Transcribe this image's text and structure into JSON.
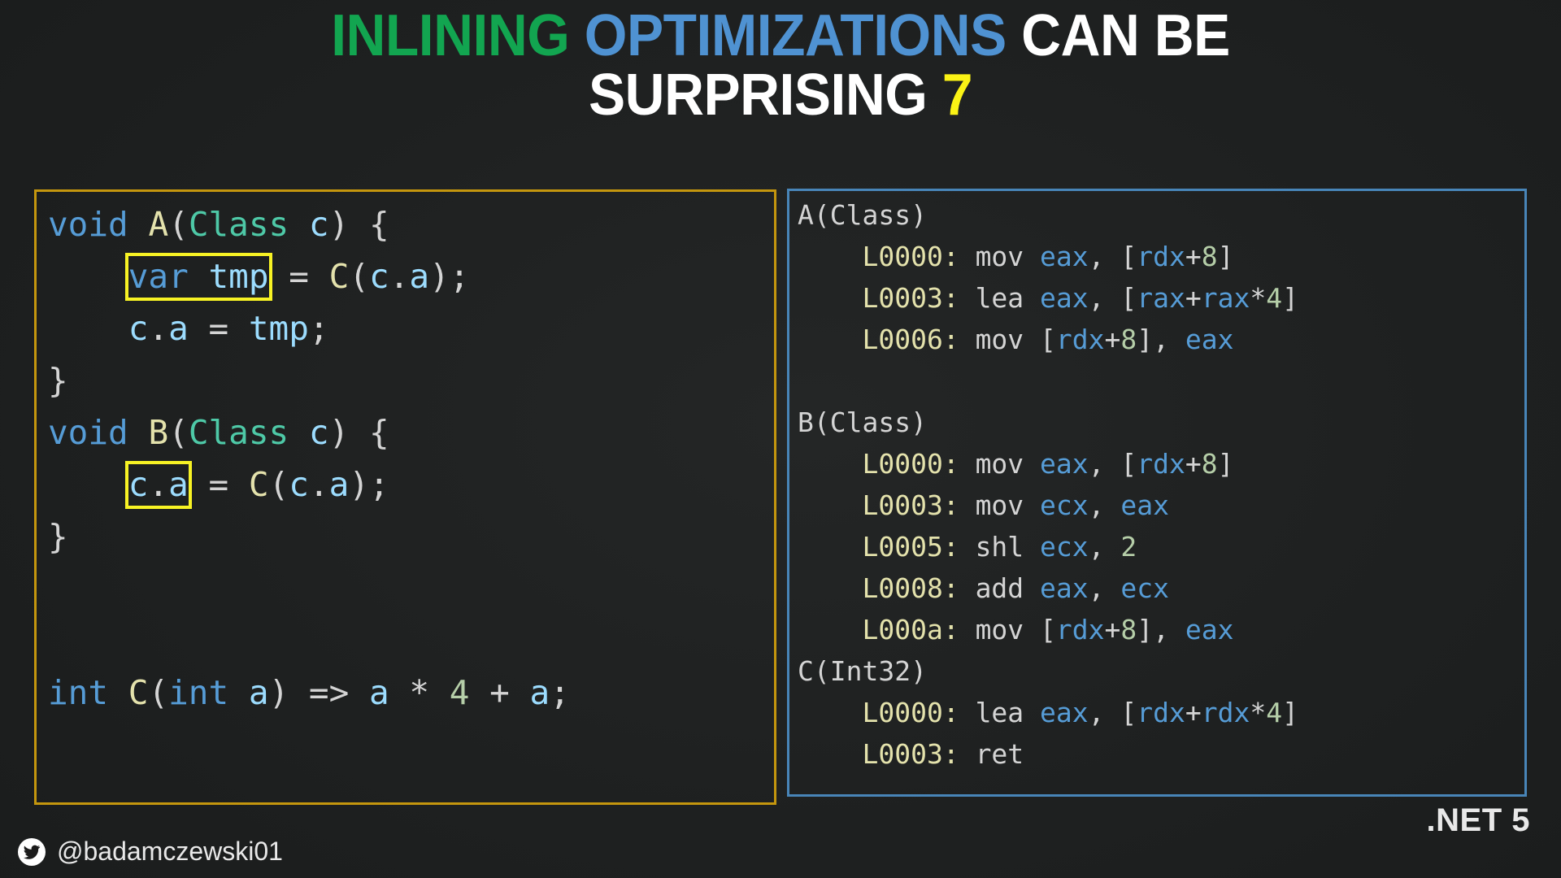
{
  "title": {
    "line1_part1": "INLINING",
    "line1_part2": "OPTIMIZATIONS",
    "line1_part3": "CAN BE",
    "line2_part1": "SURPRISING",
    "line2_part2": "7",
    "colors": {
      "green": "#12a550",
      "blue": "#4f92d2",
      "white": "#ffffff",
      "yellow": "#fbf315"
    }
  },
  "code_panel": {
    "border_color": "#c4960e",
    "highlight_color": "#f7f224",
    "lines": [
      {
        "id": "l1",
        "tokens": [
          {
            "t": "void",
            "c": "kw"
          },
          {
            "t": " ",
            "c": "punct"
          },
          {
            "t": "A",
            "c": "fn"
          },
          {
            "t": "(",
            "c": "punct"
          },
          {
            "t": "Class",
            "c": "type"
          },
          {
            "t": " ",
            "c": "punct"
          },
          {
            "t": "c",
            "c": "var"
          },
          {
            "t": ") {",
            "c": "punct"
          }
        ]
      },
      {
        "id": "l2",
        "indent": 4,
        "highlight": "var tmp",
        "tokens": [
          {
            "t": "var",
            "c": "kw"
          },
          {
            "t": " ",
            "c": "punct"
          },
          {
            "t": "tmp",
            "c": "var"
          }
        ],
        "after": [
          {
            "t": " = ",
            "c": "op"
          },
          {
            "t": "C",
            "c": "fn"
          },
          {
            "t": "(",
            "c": "punct"
          },
          {
            "t": "c",
            "c": "var"
          },
          {
            "t": ".",
            "c": "punct"
          },
          {
            "t": "a",
            "c": "var"
          },
          {
            "t": ");",
            "c": "punct"
          }
        ]
      },
      {
        "id": "l3",
        "indent": 4,
        "tokens": [
          {
            "t": "c",
            "c": "var"
          },
          {
            "t": ".",
            "c": "punct"
          },
          {
            "t": "a",
            "c": "var"
          },
          {
            "t": " = ",
            "c": "op"
          },
          {
            "t": "tmp",
            "c": "var"
          },
          {
            "t": ";",
            "c": "punct"
          }
        ]
      },
      {
        "id": "l4",
        "tokens": [
          {
            "t": "}",
            "c": "punct"
          }
        ]
      },
      {
        "id": "l5",
        "tokens": [
          {
            "t": "void",
            "c": "kw"
          },
          {
            "t": " ",
            "c": "punct"
          },
          {
            "t": "B",
            "c": "fn"
          },
          {
            "t": "(",
            "c": "punct"
          },
          {
            "t": "Class",
            "c": "type"
          },
          {
            "t": " ",
            "c": "punct"
          },
          {
            "t": "c",
            "c": "var"
          },
          {
            "t": ") {",
            "c": "punct"
          }
        ]
      },
      {
        "id": "l6",
        "indent": 4,
        "highlight": "c.a",
        "tokens": [
          {
            "t": "c",
            "c": "var"
          },
          {
            "t": ".",
            "c": "punct"
          },
          {
            "t": "a",
            "c": "var"
          }
        ],
        "after": [
          {
            "t": " = ",
            "c": "op"
          },
          {
            "t": "C",
            "c": "fn"
          },
          {
            "t": "(",
            "c": "punct"
          },
          {
            "t": "c",
            "c": "var"
          },
          {
            "t": ".",
            "c": "punct"
          },
          {
            "t": "a",
            "c": "var"
          },
          {
            "t": ");",
            "c": "punct"
          }
        ]
      },
      {
        "id": "l7",
        "tokens": [
          {
            "t": "}",
            "c": "punct"
          }
        ]
      },
      {
        "id": "l8",
        "tokens": []
      },
      {
        "id": "l9",
        "tokens": []
      },
      {
        "id": "l10",
        "tokens": [
          {
            "t": "int",
            "c": "kw"
          },
          {
            "t": " ",
            "c": "punct"
          },
          {
            "t": "C",
            "c": "fn"
          },
          {
            "t": "(",
            "c": "punct"
          },
          {
            "t": "int",
            "c": "kw"
          },
          {
            "t": " ",
            "c": "punct"
          },
          {
            "t": "a",
            "c": "var"
          },
          {
            "t": ")",
            "c": "punct"
          },
          {
            "t": " => ",
            "c": "op"
          },
          {
            "t": "a",
            "c": "var"
          },
          {
            "t": " ",
            "c": "punct"
          },
          {
            "t": "*",
            "c": "op"
          },
          {
            "t": " ",
            "c": "punct"
          },
          {
            "t": "4",
            "c": "num"
          },
          {
            "t": " ",
            "c": "punct"
          },
          {
            "t": "+",
            "c": "op"
          },
          {
            "t": " ",
            "c": "punct"
          },
          {
            "t": "a",
            "c": "var"
          },
          {
            "t": ";",
            "c": "punct"
          }
        ]
      }
    ]
  },
  "asm_panel": {
    "border_color": "#4885b8",
    "lines": [
      {
        "id": "a1",
        "tokens": [
          {
            "t": "A(Class)",
            "c": "sig"
          }
        ]
      },
      {
        "id": "a2",
        "indent": 4,
        "tokens": [
          {
            "t": "L0000: ",
            "c": "label"
          },
          {
            "t": "mov ",
            "c": "mn"
          },
          {
            "t": "eax",
            "c": "reg"
          },
          {
            "t": ", [",
            "c": "mn"
          },
          {
            "t": "rdx",
            "c": "reg"
          },
          {
            "t": "+",
            "c": "mn"
          },
          {
            "t": "8",
            "c": "asmnum"
          },
          {
            "t": "]",
            "c": "mn"
          }
        ]
      },
      {
        "id": "a3",
        "indent": 4,
        "tokens": [
          {
            "t": "L0003: ",
            "c": "label"
          },
          {
            "t": "lea ",
            "c": "mn"
          },
          {
            "t": "eax",
            "c": "reg"
          },
          {
            "t": ", [",
            "c": "mn"
          },
          {
            "t": "rax",
            "c": "reg"
          },
          {
            "t": "+",
            "c": "mn"
          },
          {
            "t": "rax",
            "c": "reg"
          },
          {
            "t": "*",
            "c": "mn"
          },
          {
            "t": "4",
            "c": "asmnum"
          },
          {
            "t": "]",
            "c": "mn"
          }
        ]
      },
      {
        "id": "a4",
        "indent": 4,
        "tokens": [
          {
            "t": "L0006: ",
            "c": "label"
          },
          {
            "t": "mov [",
            "c": "mn"
          },
          {
            "t": "rdx",
            "c": "reg"
          },
          {
            "t": "+",
            "c": "mn"
          },
          {
            "t": "8",
            "c": "asmnum"
          },
          {
            "t": "], ",
            "c": "mn"
          },
          {
            "t": "eax",
            "c": "reg"
          }
        ]
      },
      {
        "id": "a5",
        "tokens": []
      },
      {
        "id": "a6",
        "tokens": [
          {
            "t": "B(Class)",
            "c": "sig"
          }
        ]
      },
      {
        "id": "a7",
        "indent": 4,
        "tokens": [
          {
            "t": "L0000: ",
            "c": "label"
          },
          {
            "t": "mov ",
            "c": "mn"
          },
          {
            "t": "eax",
            "c": "reg"
          },
          {
            "t": ", [",
            "c": "mn"
          },
          {
            "t": "rdx",
            "c": "reg"
          },
          {
            "t": "+",
            "c": "mn"
          },
          {
            "t": "8",
            "c": "asmnum"
          },
          {
            "t": "]",
            "c": "mn"
          }
        ]
      },
      {
        "id": "a8",
        "indent": 4,
        "tokens": [
          {
            "t": "L0003: ",
            "c": "label"
          },
          {
            "t": "mov ",
            "c": "mn"
          },
          {
            "t": "ecx",
            "c": "reg"
          },
          {
            "t": ", ",
            "c": "mn"
          },
          {
            "t": "eax",
            "c": "reg"
          }
        ]
      },
      {
        "id": "a9",
        "indent": 4,
        "tokens": [
          {
            "t": "L0005: ",
            "c": "label"
          },
          {
            "t": "shl ",
            "c": "mn"
          },
          {
            "t": "ecx",
            "c": "reg"
          },
          {
            "t": ", ",
            "c": "mn"
          },
          {
            "t": "2",
            "c": "asmnum"
          }
        ]
      },
      {
        "id": "a10",
        "indent": 4,
        "tokens": [
          {
            "t": "L0008: ",
            "c": "label"
          },
          {
            "t": "add ",
            "c": "mn"
          },
          {
            "t": "eax",
            "c": "reg"
          },
          {
            "t": ", ",
            "c": "mn"
          },
          {
            "t": "ecx",
            "c": "reg"
          }
        ]
      },
      {
        "id": "a11",
        "indent": 4,
        "tokens": [
          {
            "t": "L000a: ",
            "c": "label"
          },
          {
            "t": "mov [",
            "c": "mn"
          },
          {
            "t": "rdx",
            "c": "reg"
          },
          {
            "t": "+",
            "c": "mn"
          },
          {
            "t": "8",
            "c": "asmnum"
          },
          {
            "t": "], ",
            "c": "mn"
          },
          {
            "t": "eax",
            "c": "reg"
          }
        ]
      },
      {
        "id": "a12",
        "tokens": [
          {
            "t": "C(Int32)",
            "c": "sig"
          }
        ]
      },
      {
        "id": "a13",
        "indent": 4,
        "tokens": [
          {
            "t": "L0000: ",
            "c": "label"
          },
          {
            "t": "lea ",
            "c": "mn"
          },
          {
            "t": "eax",
            "c": "reg"
          },
          {
            "t": ", [",
            "c": "mn"
          },
          {
            "t": "rdx",
            "c": "reg"
          },
          {
            "t": "+",
            "c": "mn"
          },
          {
            "t": "rdx",
            "c": "reg"
          },
          {
            "t": "*",
            "c": "mn"
          },
          {
            "t": "4",
            "c": "asmnum"
          },
          {
            "t": "]",
            "c": "mn"
          }
        ]
      },
      {
        "id": "a14",
        "indent": 4,
        "tokens": [
          {
            "t": "L0003: ",
            "c": "label"
          },
          {
            "t": "ret",
            "c": "mn"
          }
        ]
      }
    ]
  },
  "footer": {
    "twitter_icon": "twitter-bird-icon",
    "twitter_handle": "@badamczewski01",
    "dotnet_version": ".NET 5"
  }
}
